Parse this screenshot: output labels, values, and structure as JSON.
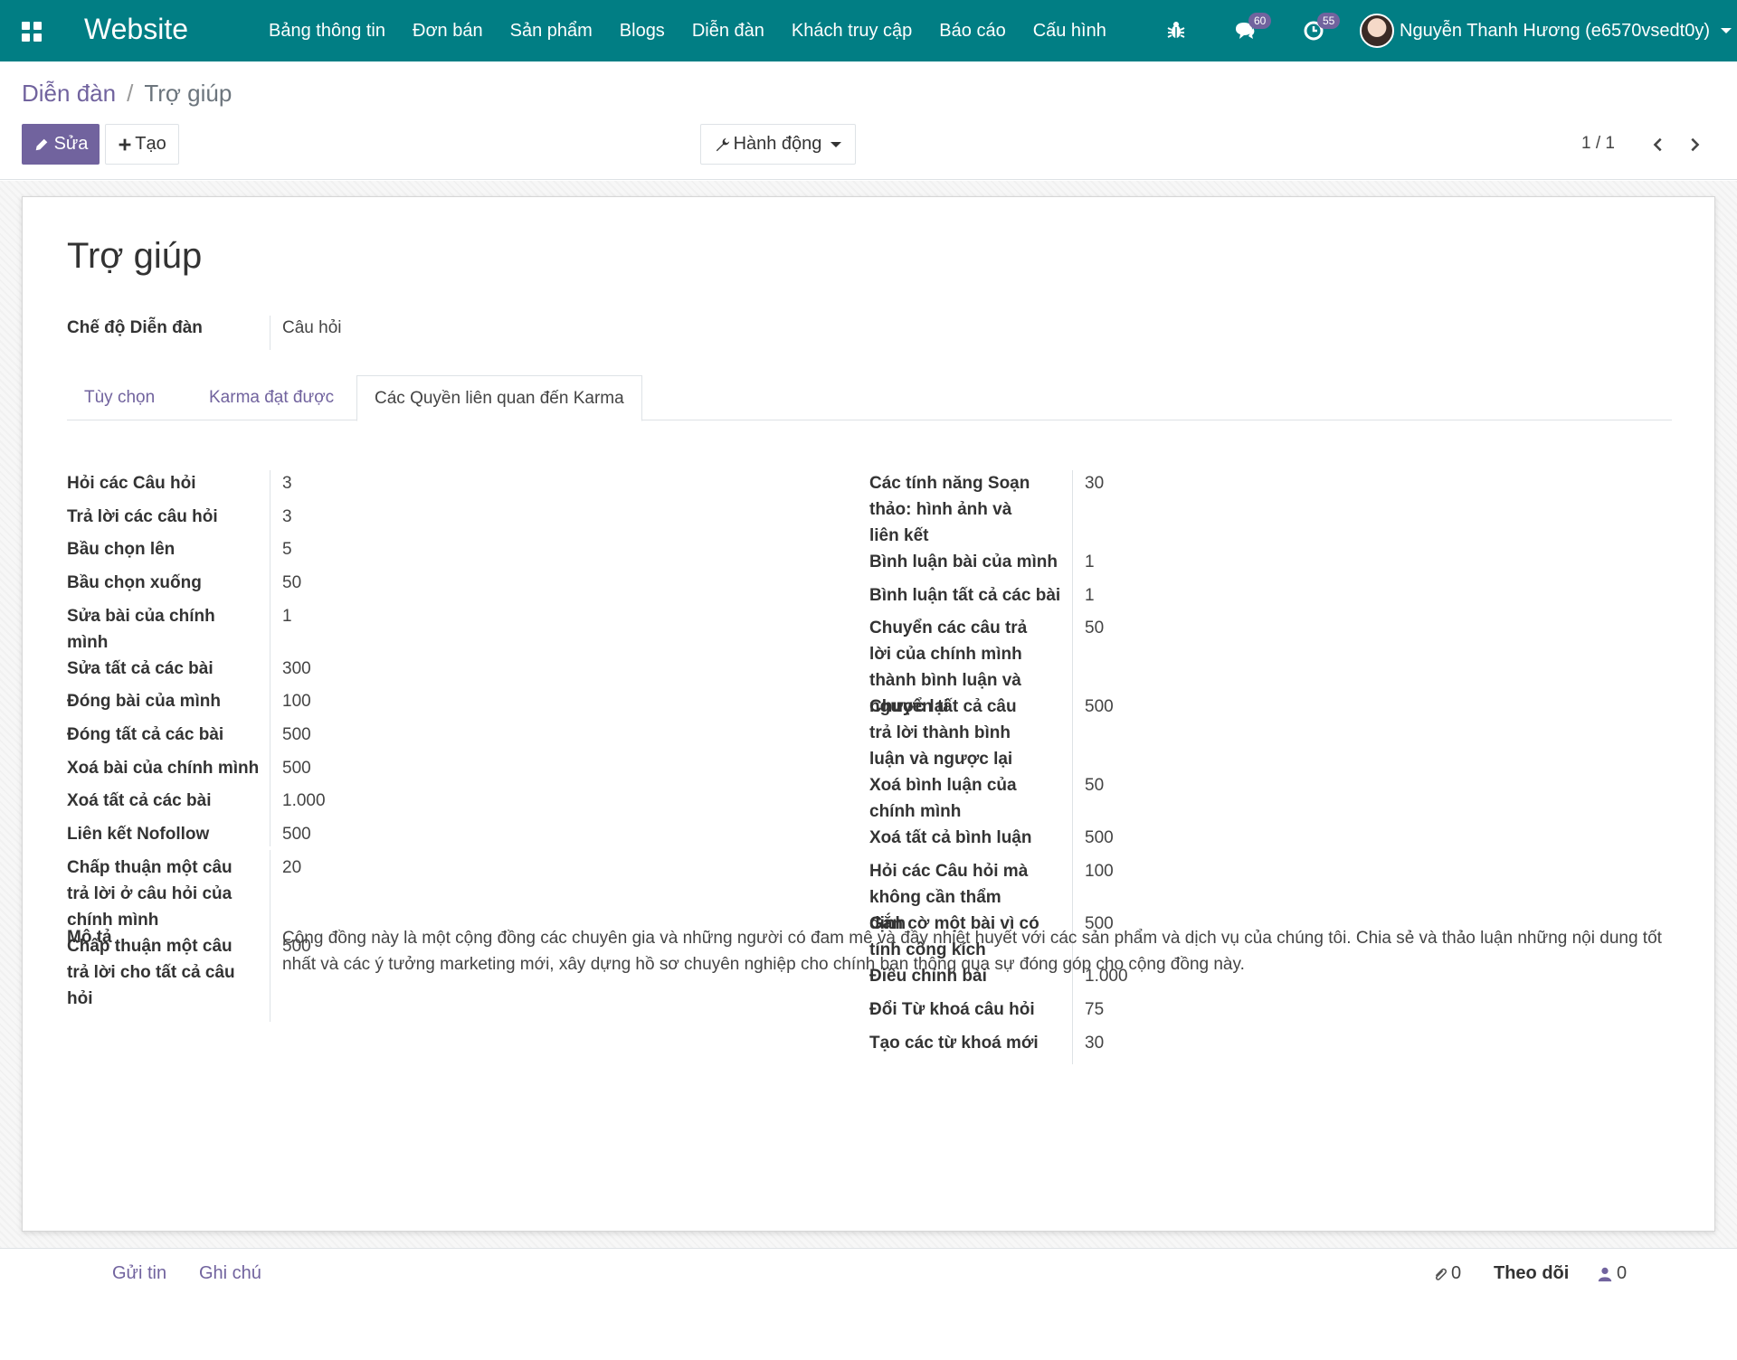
{
  "navbar": {
    "brand": "Website",
    "menu": [
      "Bảng thông tin",
      "Đơn bán",
      "Sản phẩm",
      "Blogs",
      "Diễn đàn",
      "Khách truy cập",
      "Báo cáo",
      "Cấu hình"
    ],
    "messages_count": "60",
    "activities_count": "55",
    "user_name": "Nguyễn Thanh Hương (e6570vsedt0y)"
  },
  "breadcrumb": {
    "parent": "Diễn đàn",
    "current": "Trợ giúp"
  },
  "toolbar": {
    "edit_label": "Sửa",
    "create_label": "Tạo",
    "action_label": "Hành động",
    "pager": "1 / 1"
  },
  "form": {
    "title": "Trợ giúp",
    "mode_label": "Chế độ Diễn đàn",
    "mode_value": "Câu hỏi",
    "tabs": [
      "Tùy chọn",
      "Karma đạt được",
      "Các Quyền liên quan đến Karma"
    ],
    "left_fields": [
      {
        "label": "Hỏi các Câu hỏi",
        "value": "3"
      },
      {
        "label": "Trả lời các câu hỏi",
        "value": "3"
      },
      {
        "label": "Bầu chọn lên",
        "value": "5"
      },
      {
        "label": "Bầu chọn xuống",
        "value": "50"
      },
      {
        "label": "Sửa bài của chính mình",
        "value": "1"
      },
      {
        "label": "Sửa tất cả các bài",
        "value": "300"
      },
      {
        "label": "Đóng bài của mình",
        "value": "100"
      },
      {
        "label": "Đóng tất cả các bài",
        "value": "500"
      },
      {
        "label": "Xoá bài của chính mình",
        "value": "500"
      },
      {
        "label": "Xoá tất cả các bài",
        "value": "1.000"
      },
      {
        "label": "Liên kết Nofollow",
        "value": "500"
      },
      {
        "label": "Chấp thuận một câu trả lời ở câu hỏi của chính mình",
        "value": "20"
      },
      {
        "label": "Chấp thuận một câu trả lời cho tất cả câu hỏi",
        "value": "500"
      }
    ],
    "right_fields": [
      {
        "label": "Các tính năng Soạn thảo: hình ảnh và liên kết",
        "value": "30"
      },
      {
        "label": "Bình luận bài của mình",
        "value": "1"
      },
      {
        "label": "Bình luận tất cả các bài",
        "value": "1"
      },
      {
        "label": "Chuyển các câu trả lời của chính mình thành bình luận và ngược lại",
        "value": "50"
      },
      {
        "label": "Chuyển tất cả câu trả lời thành bình luận và ngược lại",
        "value": "500"
      },
      {
        "label": "Xoá bình luận của chính mình",
        "value": "50"
      },
      {
        "label": "Xoá tất cả bình luận",
        "value": "500"
      },
      {
        "label": "Hỏi các Câu hỏi mà không cần thẩm định",
        "value": "100"
      },
      {
        "label": "Gắn cờ một bài vì có tính công kích",
        "value": "500"
      },
      {
        "label": "Điều chỉnh bài",
        "value": "1.000"
      },
      {
        "label": "Đổi Từ khoá câu hỏi",
        "value": "75"
      },
      {
        "label": "Tạo các từ khoá mới",
        "value": "30"
      }
    ],
    "description_label": "Mô tả",
    "description": "Cộng đồng này là một cộng đồng các chuyên gia và những người có đam mê và đầy nhiệt huyết với các sản phẩm và dịch vụ của chúng tôi. Chia sẻ và thảo luận những nội dung tốt nhất và các ý tưởng marketing mới, xây dựng hồ sơ chuyên nghiệp cho chính bạn thông qua sự đóng góp cho cộng đồng này."
  },
  "chatter": {
    "send_message": "Gửi tin",
    "log_note": "Ghi chú",
    "attachments_count": "0",
    "follow_label": "Theo dõi",
    "followers_count": "0"
  },
  "colors": {
    "navbar": "#017e84",
    "primary": "#71639e"
  },
  "icons": [
    "apps-icon",
    "bug-icon",
    "chat-icon",
    "clock-icon",
    "pencil-icon",
    "plus-icon",
    "wrench-icon",
    "chevron-left-icon",
    "chevron-right-icon",
    "paperclip-icon",
    "user-icon"
  ]
}
